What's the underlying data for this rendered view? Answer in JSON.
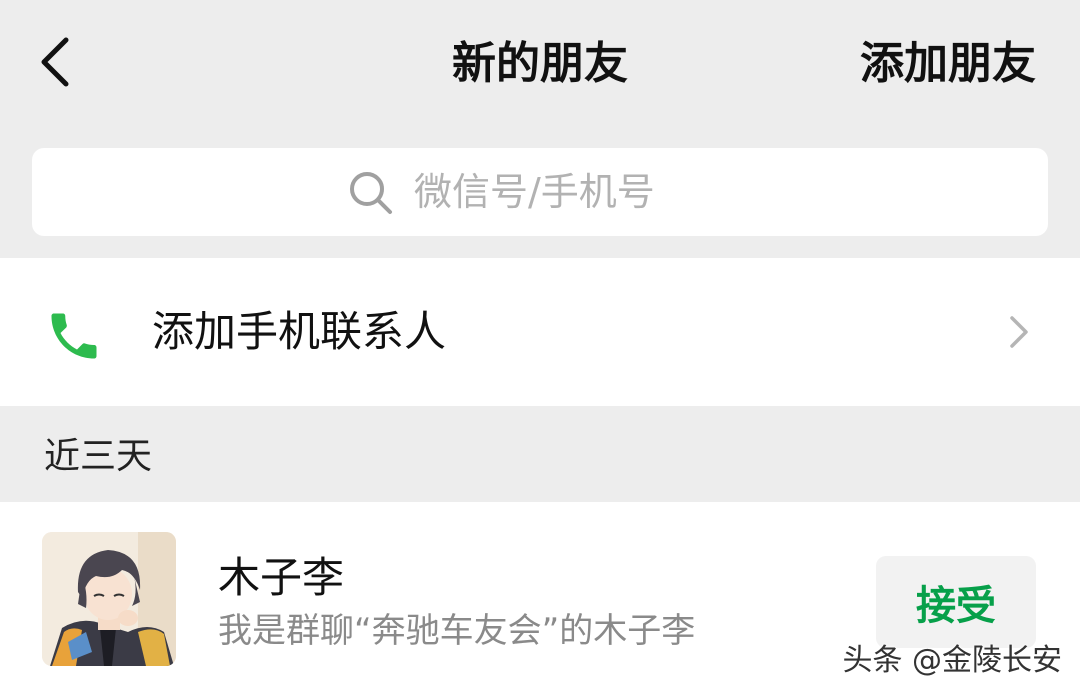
{
  "header": {
    "back_icon": "chevron-left-icon",
    "title": "新的朋友",
    "right_action": "添加朋友"
  },
  "search": {
    "icon": "search-icon",
    "placeholder": "微信号/手机号"
  },
  "add_phone_contacts": {
    "icon": "phone-icon",
    "label": "添加手机联系人",
    "chevron_icon": "chevron-right-icon"
  },
  "section": {
    "label": "近三天"
  },
  "friend_requests": [
    {
      "name": "木子李",
      "message": "我是群聊“奔驰车友会”的木子李",
      "action": "接受",
      "avatar": "avatar-anime-boy"
    }
  ],
  "watermark": "头条 @金陵长安",
  "colors": {
    "background": "#ededed",
    "accent_green": "#07a04a",
    "phone_icon_green": "#2dbb4e"
  }
}
